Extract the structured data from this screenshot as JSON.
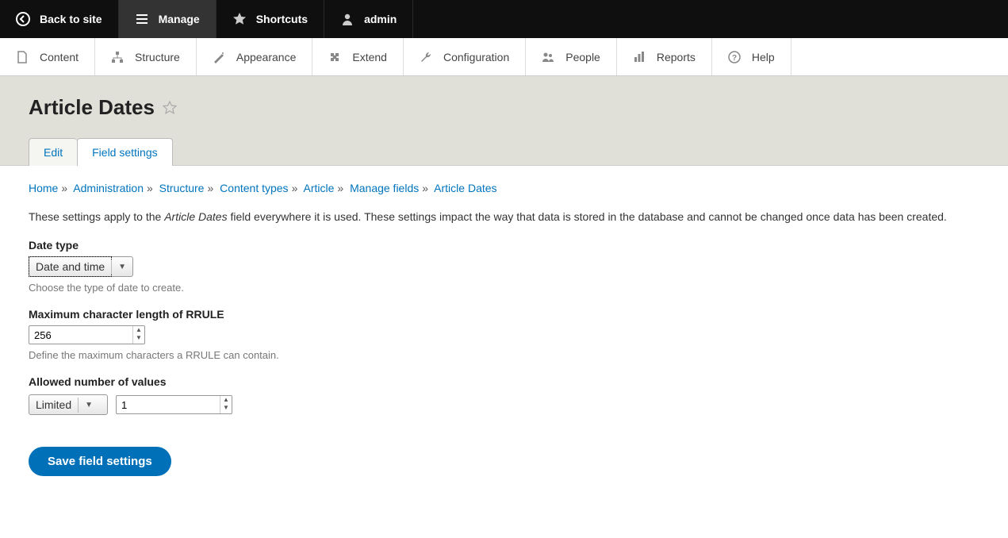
{
  "toolbar": {
    "back": "Back to site",
    "manage": "Manage",
    "shortcuts": "Shortcuts",
    "user": "admin"
  },
  "admin_menu": {
    "content": "Content",
    "structure": "Structure",
    "appearance": "Appearance",
    "extend": "Extend",
    "configuration": "Configuration",
    "people": "People",
    "reports": "Reports",
    "help": "Help"
  },
  "page": {
    "title": "Article Dates"
  },
  "tabs": {
    "edit": "Edit",
    "field_settings": "Field settings"
  },
  "breadcrumb": {
    "home": "Home",
    "administration": "Administration",
    "structure": "Structure",
    "content_types": "Content types",
    "article": "Article",
    "manage_fields": "Manage fields",
    "article_dates": "Article Dates"
  },
  "intro": {
    "pre": "These settings apply to the ",
    "em": "Article Dates",
    "post": " field everywhere it is used. These settings impact the way that data is stored in the database and cannot be changed once data has been created."
  },
  "fields": {
    "date_type": {
      "label": "Date type",
      "value": "Date and time",
      "help": "Choose the type of date to create."
    },
    "rrule": {
      "label": "Maximum character length of RRULE",
      "value": "256",
      "help": "Define the maximum characters a RRULE can contain."
    },
    "allowed": {
      "label": "Allowed number of values",
      "limit": "Limited",
      "count": "1"
    }
  },
  "buttons": {
    "save": "Save field settings"
  }
}
